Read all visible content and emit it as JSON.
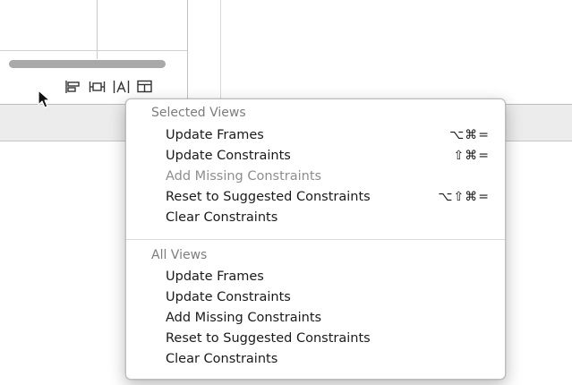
{
  "toolbar": {
    "icons": [
      "align-icon",
      "pin-icon",
      "resolve-issues-icon",
      "resizing-icon"
    ]
  },
  "menu": {
    "selected_views": {
      "header": "Selected Views",
      "items": [
        {
          "label": "Update Frames",
          "shortcut": "⌥⌘=",
          "enabled": true
        },
        {
          "label": "Update Constraints",
          "shortcut": "⇧⌘=",
          "enabled": true
        },
        {
          "label": "Add Missing Constraints",
          "shortcut": "",
          "enabled": false
        },
        {
          "label": "Reset to Suggested Constraints",
          "shortcut": "⌥⇧⌘=",
          "enabled": true
        },
        {
          "label": "Clear Constraints",
          "shortcut": "",
          "enabled": true
        }
      ]
    },
    "all_views": {
      "header": "All Views",
      "items": [
        {
          "label": "Update Frames",
          "enabled": true
        },
        {
          "label": "Update Constraints",
          "enabled": true
        },
        {
          "label": "Add Missing Constraints",
          "enabled": true
        },
        {
          "label": "Reset to Suggested Constraints",
          "enabled": true
        },
        {
          "label": "Clear Constraints",
          "enabled": true
        }
      ]
    }
  },
  "colors": {
    "menu_background": "#ffffff",
    "disabled_text": "#8e8e8e",
    "header_text": "#7d7d7d"
  }
}
